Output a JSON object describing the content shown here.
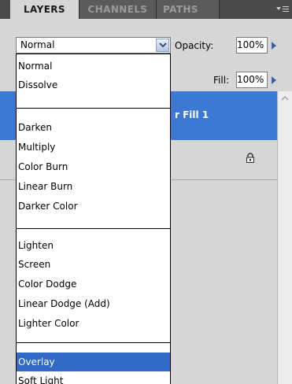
{
  "tabs": {
    "layers": "LAYERS",
    "channels": "CHANNELS",
    "paths": "PATHS"
  },
  "blend_mode": {
    "selected": "Normal",
    "options": [
      [
        "Normal",
        "Dissolve"
      ],
      [
        "Darken",
        "Multiply",
        "Color Burn",
        "Linear Burn",
        "Darker Color"
      ],
      [
        "Lighten",
        "Screen",
        "Color Dodge",
        "Linear Dodge (Add)",
        "Lighter Color"
      ],
      [
        "Overlay",
        "Soft Light"
      ]
    ],
    "highlighted": "Overlay"
  },
  "opacity": {
    "label": "Opacity:",
    "value": "100%"
  },
  "fill": {
    "label": "Fill:",
    "value": "100%"
  },
  "layers": {
    "selected_layer_name": "r Fill 1"
  },
  "icons": {
    "panel_menu": "panel-menu-icon",
    "dropdown_arrow": "chevron-down-icon",
    "value_arrow": "triangle-right-icon",
    "lock": "lock-icon",
    "scroll_up": "scroll-up-arrow-icon"
  },
  "colors": {
    "selection_blue": "#3c78d4",
    "dropdown_highlight": "#3169c6",
    "tab_bar": "#4a4a4a"
  }
}
